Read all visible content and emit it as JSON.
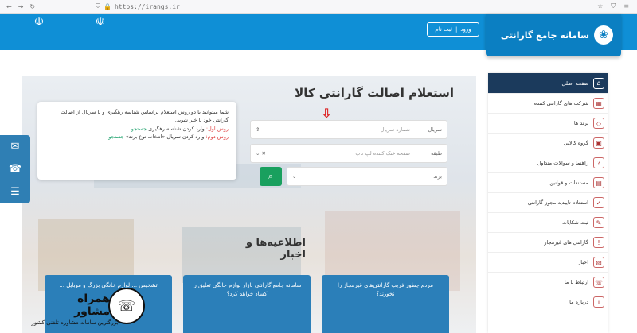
{
  "browser": {
    "url": "https://irangs.ir",
    "nav_icons": [
      "back-icon",
      "forward-icon",
      "reload-icon"
    ]
  },
  "header": {
    "login_label": "ورود",
    "register_label": "ثبت نام",
    "brand_title": "سامانه جامع گارانتی"
  },
  "hero": {
    "headline": "استعلام اصالت گارانتی کالا"
  },
  "info_card": {
    "intro": "شما میتوانید با دو روش استعلام براساس شناسه رهگیری و یا سریال از اصالت گارانتی خود با خبر شوید.",
    "way1_label": "روش اول:",
    "way1_text": "وارد کردن شناسه رهگیری",
    "way1_search": "جستجو",
    "way2_label": "روش دوم:",
    "way2_text": "وارد کردن سریال «انتخاب نوع برند»",
    "way2_search": "جستجو"
  },
  "form": {
    "serial_label": "سریال",
    "serial_placeholder": "شماره سریال",
    "category_label": "طبقه",
    "category_placeholder": "صفحه خنک کننده لپ تاپ",
    "brand_label": "برند"
  },
  "news": {
    "title": "اطلاعیه‌ها و اخبار",
    "cards": [
      "مردم چطور فریب گارانتی‌های غیرمجاز را نخورند؟",
      "سامانه جامع گارانتی بازار لوازم خانگی تعلیق را کساد خواهد کرد؟",
      "تشخیص ... لوازم خانگی بزرگ و موبایل ..."
    ]
  },
  "sidebar": {
    "items": [
      {
        "label": "صفحه اصلی",
        "icon": "home-icon"
      },
      {
        "label": "شرکت های گارانتی کننده",
        "icon": "building-icon"
      },
      {
        "label": "برند ها",
        "icon": "tag-icon"
      },
      {
        "label": "گروه کالایی",
        "icon": "box-icon"
      },
      {
        "label": "راهنما و سوالات متداول",
        "icon": "help-icon"
      },
      {
        "label": "مستندات و قوانین",
        "icon": "document-icon"
      },
      {
        "label": "استعلام تاییدیه مجوز گارانتی",
        "icon": "certificate-icon"
      },
      {
        "label": "ثبت شکایات",
        "icon": "complaint-icon"
      },
      {
        "label": "گارانتی های غیرمجاز",
        "icon": "warning-icon"
      },
      {
        "label": "اخبار",
        "icon": "news-icon"
      },
      {
        "label": "ارتباط با ما",
        "icon": "phone-icon"
      },
      {
        "label": "درباره ما",
        "icon": "info-icon"
      }
    ]
  },
  "watermark": {
    "name": "همراه مشاور",
    "tagline": "بزرگترین سامانه مشاوره تلفنی کشور"
  }
}
